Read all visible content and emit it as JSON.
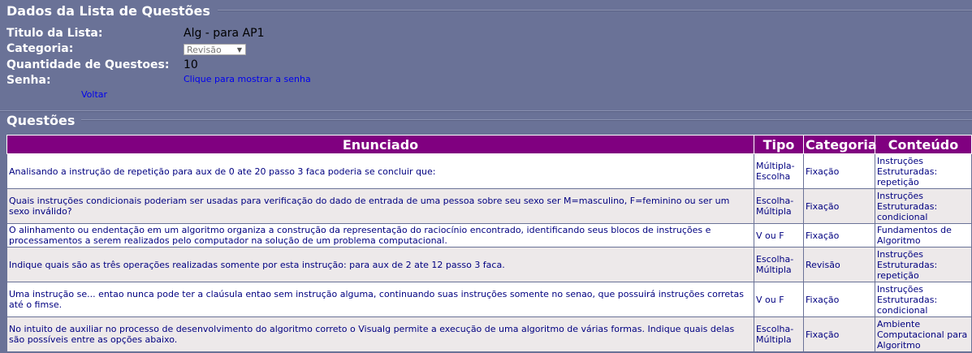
{
  "header": {
    "title": "Dados da Lista de Questões"
  },
  "fields": {
    "titulo_label": "Titulo da Lista:",
    "titulo_value": "Alg - para AP1",
    "categoria_label": "Categoria:",
    "categoria_selected": "Revisão",
    "quantidade_label": "Quantidade de Questoes:",
    "quantidade_value": "10",
    "senha_label": "Senha:",
    "senha_link": "Clique para mostrar a senha"
  },
  "voltar": "Voltar",
  "questoes": {
    "title": "Questões",
    "columns": [
      "Enunciado",
      "Tipo",
      "Categoria",
      "Conteúdo"
    ],
    "rows": [
      {
        "enunciado": "Analisando a instrução de repetição para aux de 0 ate 20 passo 3 faca poderia se concluir que:",
        "tipo": "Múltipla-Escolha",
        "categoria": "Fixação",
        "conteudo": "Instruções Estruturadas: repetição"
      },
      {
        "enunciado": "Quais instruções condicionais poderiam ser usadas para verificação do dado de entrada de uma pessoa sobre seu sexo ser M=masculino, F=feminino ou ser um sexo inválido?",
        "tipo": "Escolha-Múltipla",
        "categoria": "Fixação",
        "conteudo": "Instruções Estruturadas: condicional"
      },
      {
        "enunciado": "O alinhamento ou endentação em um algoritmo organiza a construção da representação do raciocínio encontrado, identificando seus blocos de instruções e processamentos a serem realizados pelo computador na solução de um problema computacional.",
        "tipo": "V ou F",
        "categoria": "Fixação",
        "conteudo": "Fundamentos de Algoritmo"
      },
      {
        "enunciado": "Indique quais são as três operações realizadas somente por esta instrução: para aux de 2 ate 12 passo 3 faca.",
        "tipo": "Escolha-Múltipla",
        "categoria": "Revisão",
        "conteudo": "Instruções Estruturadas: repetição"
      },
      {
        "enunciado": "Uma instrução se... entao nunca pode ter a claúsula entao sem instrução alguma, continuando suas instruções somente no senao, que possuirá instruções corretas até o fimse.",
        "tipo": "V ou F",
        "categoria": "Fixação",
        "conteudo": "Instruções Estruturadas: condicional"
      },
      {
        "enunciado": "No intuito de auxiliar no processo de desenvolvimento do algoritmo correto o Visualg permite a execução de uma algoritmo de várias formas. Indique quais delas são possíveis entre as opções abaixo.",
        "tipo": "Escolha-Múltipla",
        "categoria": "Fixação",
        "conteudo": "Ambiente Computacional para Algoritmo"
      }
    ]
  },
  "colors": {
    "background": "#6a7297",
    "table_header": "#800080",
    "cell_text": "#000080",
    "row_alt": "#ede9ea"
  }
}
